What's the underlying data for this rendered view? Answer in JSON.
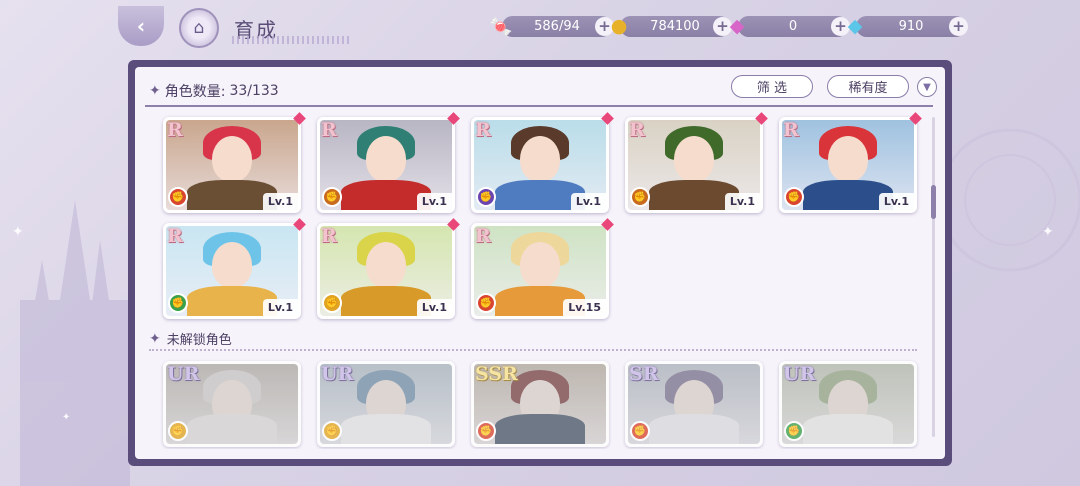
{
  "header": {
    "back_icon": "back-arrow-icon",
    "home_icon": "castle-icon",
    "title": "育成"
  },
  "resources": [
    {
      "name": "candy",
      "icon": "candy-icon",
      "value": "586/94",
      "glyph": "🍬"
    },
    {
      "name": "gold",
      "icon": "coin-icon",
      "value": "784100",
      "glyph": "●"
    },
    {
      "name": "pink-gem",
      "icon": "pink-diamond-icon",
      "value": "0",
      "glyph": "◆"
    },
    {
      "name": "blue-gem",
      "icon": "blue-diamond-icon",
      "value": "910",
      "glyph": "◆"
    }
  ],
  "panel": {
    "count_label": "角色数量:",
    "count_value": "33/133",
    "filter_label": "筛 选",
    "sort_label": "稀有度",
    "locked_section_label": "未解锁角色"
  },
  "owned": [
    {
      "rarity": "R",
      "level": "Lv.1",
      "element_color": "#d9452f",
      "hair": "#d8344a",
      "bg": "#c9a68d",
      "outfit": "#6b4f34"
    },
    {
      "rarity": "R",
      "level": "Lv.1",
      "element_color": "#c86a1f",
      "hair": "#2f7f74",
      "bg": "#b8b6c3",
      "outfit": "#c42c2c"
    },
    {
      "rarity": "R",
      "level": "Lv.1",
      "element_color": "#6a44b0",
      "hair": "#5a3a2a",
      "bg": "#b9dde9",
      "outfit": "#4f7cc0"
    },
    {
      "rarity": "R",
      "level": "Lv.1",
      "element_color": "#c86a1f",
      "hair": "#3f6a2a",
      "bg": "#d9d2c4",
      "outfit": "#6b4a2f"
    },
    {
      "rarity": "R",
      "level": "Lv.1",
      "element_color": "#d9452f",
      "hair": "#d8343a",
      "bg": "#9fc2e0",
      "outfit": "#2c4f8c"
    },
    {
      "rarity": "R",
      "level": "Lv.1",
      "element_color": "#3aa14a",
      "hair": "#6ec4e8",
      "bg": "#c9e6f2",
      "outfit": "#e8b34a"
    },
    {
      "rarity": "R",
      "level": "Lv.1",
      "element_color": "#e0a422",
      "hair": "#d9d44a",
      "bg": "#d5e6b0",
      "outfit": "#d89b2a"
    },
    {
      "rarity": "R",
      "level": "Lv.15",
      "element_color": "#d9452f",
      "hair": "#eed79a",
      "bg": "#cfe3c4",
      "outfit": "#e69a3a"
    }
  ],
  "locked": [
    {
      "rarity": "UR",
      "element_color": "#e0a422",
      "hair": "#d9d4cf",
      "bg": "#bfb6a8",
      "outfit": "#e6e2df"
    },
    {
      "rarity": "UR",
      "element_color": "#e0a422",
      "hair": "#5e9fd4",
      "bg": "#a9c4d8",
      "outfit": "#f0f0f4"
    },
    {
      "rarity": "SSR",
      "element_color": "#d9452f",
      "hair": "#b83c3c",
      "bg": "#c7b49a",
      "outfit": "#3f5f8c"
    },
    {
      "rarity": "SR",
      "element_color": "#d9452f",
      "hair": "#8a7ab8",
      "bg": "#b2c1d4",
      "outfit": "#eaeaf2"
    },
    {
      "rarity": "UR",
      "element_color": "#3aa14a",
      "hair": "#8fb86a",
      "bg": "#b9c9a8",
      "outfit": "#eef2ea"
    }
  ],
  "element_icon": "fist-icon",
  "colors": {
    "panel_border": "#5a4c7b",
    "accent": "#8d80ab",
    "corner_badge": "#e9477a"
  }
}
